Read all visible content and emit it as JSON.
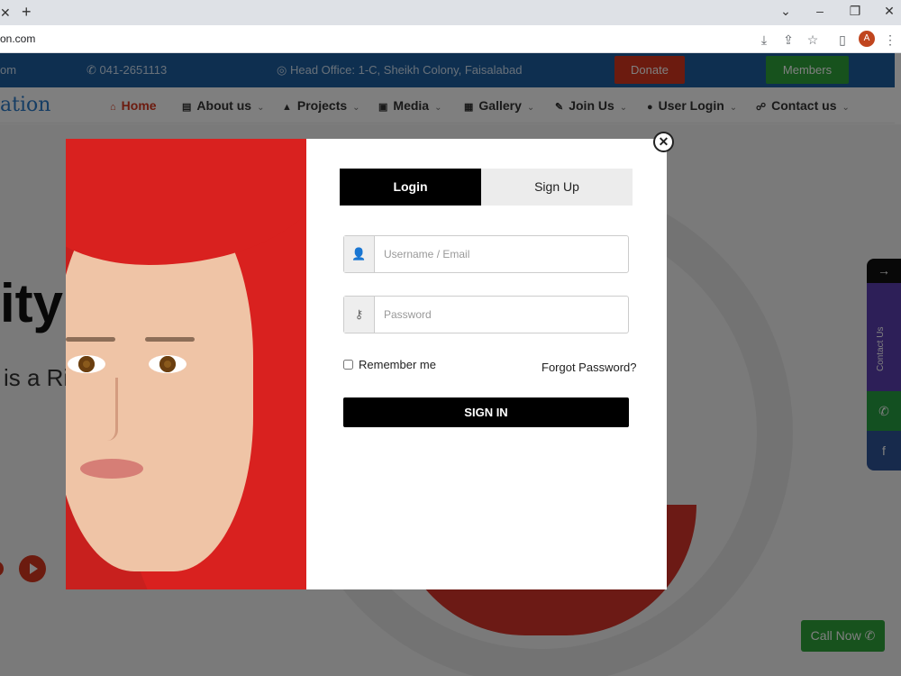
{
  "browser": {
    "url": "on.com",
    "avatar_initial": "A",
    "icons": [
      "close-icon",
      "plus-icon",
      "chevron-down-icon",
      "minimize-icon",
      "restore-icon",
      "close-window-icon",
      "install-icon",
      "share-icon",
      "star-icon",
      "sidepanel-icon",
      "menu-icon"
    ]
  },
  "site": {
    "topbar": {
      "email_fragment": "om",
      "phone": "041-2651113",
      "office": "Head Office: 1-C, Sheikh Colony, Faisalabad",
      "donate": "Donate",
      "members": "Members"
    },
    "logo_fragment": "ation",
    "nav": [
      {
        "label": "Home"
      },
      {
        "label": "About us"
      },
      {
        "label": "Projects"
      },
      {
        "label": "Media"
      },
      {
        "label": "Gallery"
      },
      {
        "label": "Join Us"
      },
      {
        "label": "User Login"
      },
      {
        "label": "Contact us"
      }
    ],
    "hero": {
      "word_fragment": "ity",
      "sub_fragment": "is a Ri"
    },
    "side_widget": {
      "contact": "Contact Us"
    },
    "call_now": "Call Now"
  },
  "modal": {
    "tabs": {
      "login": "Login",
      "signup": "Sign Up"
    },
    "username_placeholder": "Username / Email",
    "password_placeholder": "Password",
    "remember": "Remember me",
    "forgot": "Forgot Password?",
    "signin": "SIGN IN"
  },
  "colors": {
    "accent_red": "#d8371f",
    "topbar_blue": "#1d5fa0",
    "green": "#2ea53a"
  }
}
